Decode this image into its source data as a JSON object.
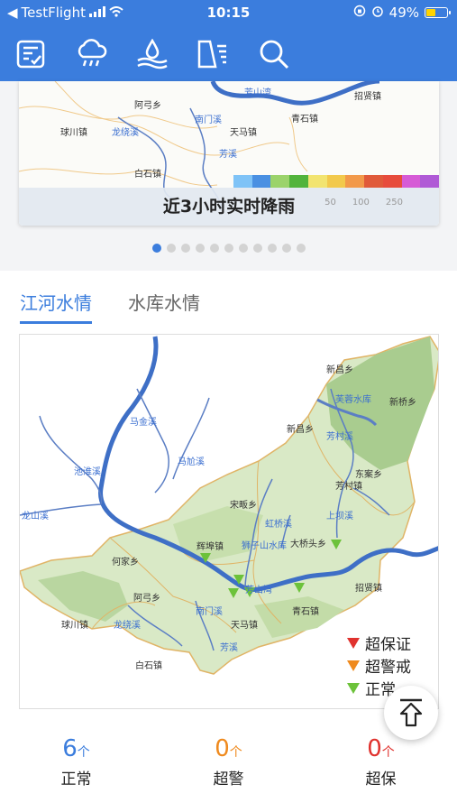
{
  "status_bar": {
    "back_app": "TestFlight",
    "time": "10:15",
    "battery": "49%",
    "battery_level": 0.49
  },
  "toolbar": {
    "icons": [
      "report-icon",
      "rain-icon",
      "water-level-icon",
      "reservoir-icon",
      "search-icon"
    ]
  },
  "rain_map": {
    "caption": "近3小时实时降雨",
    "scale_labels": [
      "50",
      "100",
      "250"
    ],
    "legend_colors": [
      "#7fc3f7",
      "#4a90e2",
      "#9bd36b",
      "#52b43c",
      "#f2e470",
      "#f2c94c",
      "#f2994a",
      "#e05a3a",
      "#e74c3c",
      "#d65bd6",
      "#b05ad6"
    ],
    "labels": [
      {
        "text": "阿弓乡"
      },
      {
        "text": "招贤镇"
      },
      {
        "text": "球川镇"
      },
      {
        "text": "龙绕溪",
        "water": true
      },
      {
        "text": "南门溪",
        "water": true
      },
      {
        "text": "天马镇"
      },
      {
        "text": "青石镇"
      },
      {
        "text": "芳溪",
        "water": true
      },
      {
        "text": "白石镇"
      },
      {
        "text": "芳山湾",
        "water": true
      }
    ]
  },
  "carousel": {
    "count": 11,
    "active": 0
  },
  "water": {
    "tabs": [
      {
        "label": "江河水情",
        "active": true
      },
      {
        "label": "水库水情",
        "active": false
      }
    ],
    "map_labels": [
      {
        "text": "马金溪",
        "water": true
      },
      {
        "text": "马尬溪",
        "water": true
      },
      {
        "text": "池淮溪",
        "water": true
      },
      {
        "text": "龙山溪",
        "water": true
      },
      {
        "text": "新昌乡"
      },
      {
        "text": "芙蓉水库",
        "water": true
      },
      {
        "text": "新桥乡"
      },
      {
        "text": "新昌乡"
      },
      {
        "text": "芳村溪",
        "water": true
      },
      {
        "text": "东案乡"
      },
      {
        "text": "芳村镇"
      },
      {
        "text": "宋畈乡"
      },
      {
        "text": "虹桥溪",
        "water": true
      },
      {
        "text": "上坝溪",
        "water": true
      },
      {
        "text": "辉埠镇"
      },
      {
        "text": "狮子山水库",
        "water": true
      },
      {
        "text": "大桥头乡"
      },
      {
        "text": "何家乡"
      },
      {
        "text": "芳山湾",
        "water": true
      },
      {
        "text": "阿弓乡"
      },
      {
        "text": "招贤镇"
      },
      {
        "text": "球川镇"
      },
      {
        "text": "龙绕溪",
        "water": true
      },
      {
        "text": "南门溪",
        "water": true
      },
      {
        "text": "天马镇"
      },
      {
        "text": "青石镇"
      },
      {
        "text": "芳溪",
        "water": true
      },
      {
        "text": "白石镇"
      }
    ],
    "legend": [
      {
        "label": "超保证",
        "color": "#e0322e"
      },
      {
        "label": "超警戒",
        "color": "#ef8a1e"
      },
      {
        "label": "正常",
        "color": "#6cc23a"
      }
    ],
    "stats": [
      {
        "value": "6",
        "unit": "个",
        "label": "正常",
        "color": "#3b7ddd"
      },
      {
        "value": "0",
        "unit": "个",
        "label": "超警",
        "color": "#ef8a1e"
      },
      {
        "value": "0",
        "unit": "个",
        "label": "超保",
        "color": "#e0322e"
      }
    ]
  }
}
